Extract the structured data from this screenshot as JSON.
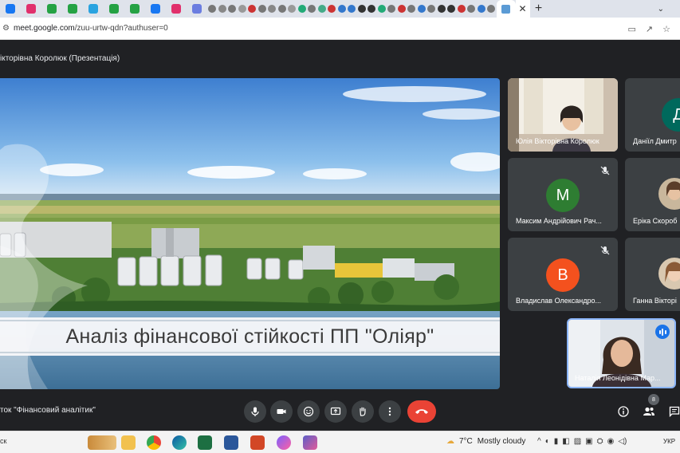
{
  "browser": {
    "url_host": "meet.google.com",
    "url_path": "/zuu-urtw-qdn?authuser=0",
    "new_tab_label": "+",
    "close_tab_label": "✕",
    "tab_colors": [
      "#1877f2",
      "#e1306c",
      "#25a244",
      "#25a244",
      "#2aa3e0",
      "#25a244",
      "#25a244",
      "#1877f2",
      "#e1306c",
      "#6b7de0"
    ]
  },
  "meet": {
    "presenter_title": "ікторівна Королюк (Презентація)",
    "slide_title": "Аналіз фінансової стійкості ПП \"Оліяр\"",
    "meeting_name": "ток \"Фінансовий аналітик\"",
    "participant_count": "8",
    "participants": [
      {
        "name": "Юлія Вікторівна Королюк"
      },
      {
        "name": "Даніїл Дмитр",
        "initial": "Д",
        "color": "#00695c"
      },
      {
        "name": "Максим Андрійович Рач...",
        "initial": "М",
        "color": "#2e7d32"
      },
      {
        "name": "Еріка Скороб"
      },
      {
        "name": "Владислав Олександро...",
        "initial": "В",
        "color": "#f4511e"
      },
      {
        "name": "Ганна Вікторі"
      },
      {
        "name": "Наталія Леонідівна Мар..."
      }
    ]
  },
  "taskbar": {
    "search_label": "ск",
    "temperature": "7°C",
    "weather": "Mostly cloudy",
    "language": "УКР"
  }
}
